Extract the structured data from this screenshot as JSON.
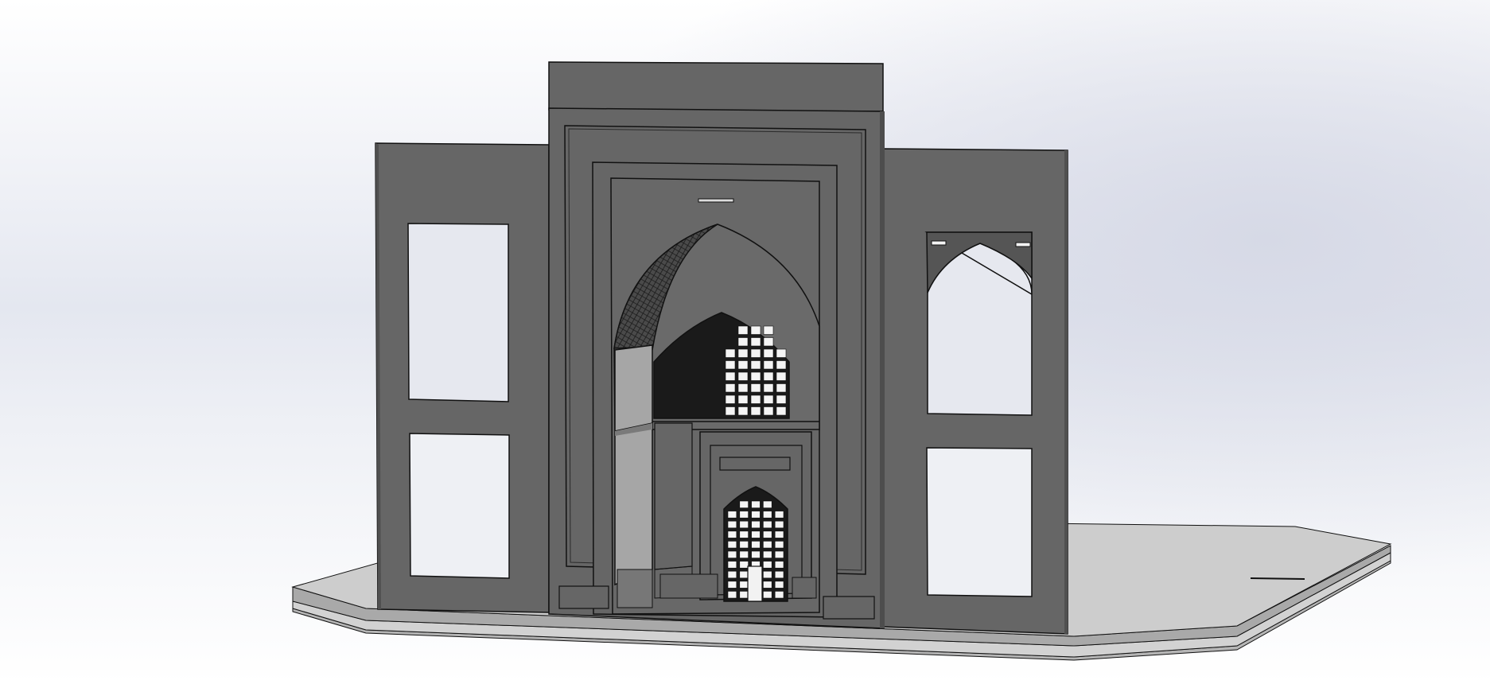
{
  "viewport": {
    "background_gradient": [
      "#ffffff",
      "#e4e7f0",
      "#d9dce8",
      "#ffffff"
    ],
    "model_colors": {
      "facade": "#666666",
      "facade_dark": "#5a5a5a",
      "base_plate": "#cfcfcf",
      "base_plate_edge": "#9a9a9a",
      "opening_fill": "#e9ebf1",
      "screen_white": "#f4f4f4",
      "edge": "#111111"
    },
    "lattice_panels": [
      {
        "columns": 5,
        "rows": 8
      },
      {
        "columns": 5,
        "rows": 10
      }
    ]
  }
}
